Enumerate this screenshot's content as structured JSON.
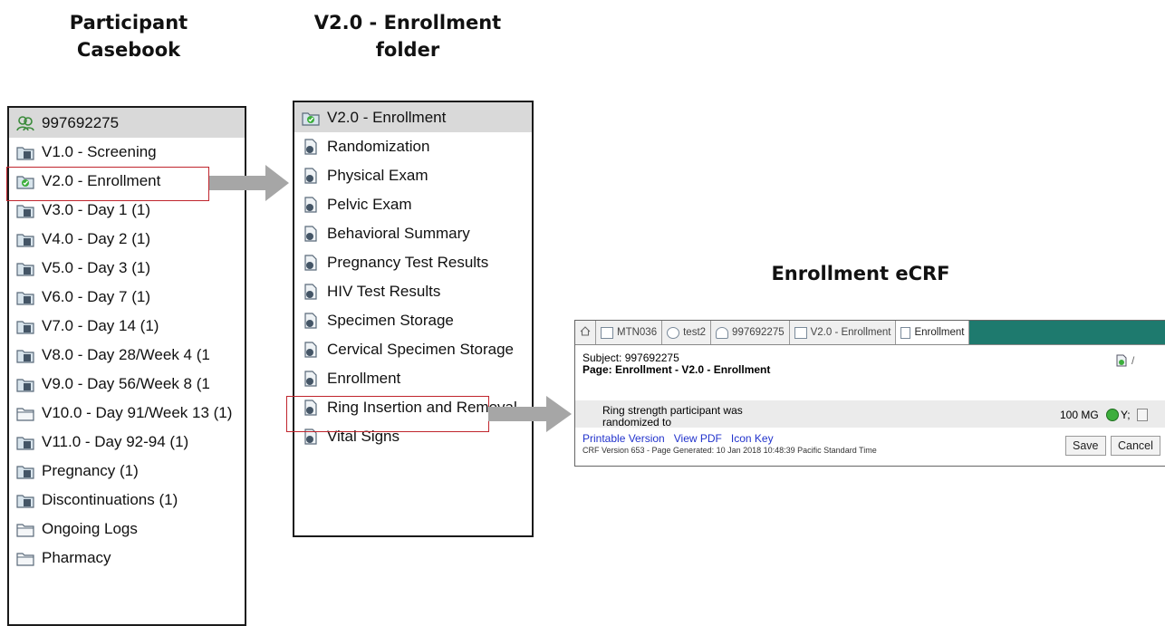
{
  "headings": {
    "casebook": [
      "Participant",
      "Casebook"
    ],
    "folder": [
      "V2.0 - Enrollment",
      "folder"
    ],
    "ecrf": "Enrollment eCRF"
  },
  "casebook": {
    "header": "997692275",
    "items": [
      {
        "label": "V1.0 - Screening",
        "icon": "folder-form-icon"
      },
      {
        "label": "V2.0 - Enrollment",
        "icon": "folder-complete-icon"
      },
      {
        "label": "V3.0 - Day 1 (1)",
        "icon": "folder-form-icon"
      },
      {
        "label": "V4.0 - Day 2 (1)",
        "icon": "folder-form-icon"
      },
      {
        "label": "V5.0 - Day 3 (1)",
        "icon": "folder-form-icon"
      },
      {
        "label": "V6.0 - Day 7 (1)",
        "icon": "folder-form-icon"
      },
      {
        "label": "V7.0 - Day 14 (1)",
        "icon": "folder-form-icon"
      },
      {
        "label": "V8.0 - Day 28/Week 4 (1",
        "icon": "folder-form-icon"
      },
      {
        "label": "V9.0 - Day 56/Week 8 (1",
        "icon": "folder-form-icon"
      },
      {
        "label": "V10.0 - Day 91/Week 13 (1)",
        "icon": "folder-empty-icon"
      },
      {
        "label": "V11.0 - Day 92-94 (1)",
        "icon": "folder-form-icon"
      },
      {
        "label": "Pregnancy (1)",
        "icon": "folder-form-icon"
      },
      {
        "label": "Discontinuations (1)",
        "icon": "folder-form-icon"
      },
      {
        "label": "Ongoing Logs",
        "icon": "folder-empty-icon"
      },
      {
        "label": "Pharmacy",
        "icon": "folder-empty-icon"
      }
    ]
  },
  "folder": {
    "header": "V2.0 - Enrollment",
    "items": [
      {
        "label": "Randomization"
      },
      {
        "label": "Physical Exam"
      },
      {
        "label": "Pelvic Exam"
      },
      {
        "label": "Behavioral Summary"
      },
      {
        "label": "Pregnancy Test Results"
      },
      {
        "label": "HIV Test Results"
      },
      {
        "label": "Specimen Storage"
      },
      {
        "label": "Cervical Specimen Storage"
      },
      {
        "label": "Enrollment"
      },
      {
        "label": "Ring Insertion and Removal"
      },
      {
        "label": "Vital Signs"
      }
    ]
  },
  "ecrf": {
    "tabs": [
      "MTN036",
      "test2",
      "997692275",
      "V2.0 - Enrollment",
      "Enrollment"
    ],
    "subject": "Subject: 997692275",
    "page": "Page: Enrollment - V2.0 - Enrollment",
    "question": "Ring strength participant was randomized to",
    "answer": "100 MG",
    "answer_flag": "Y;",
    "links": {
      "printable": "Printable Version",
      "pdf": "View PDF",
      "icon_key": "Icon Key"
    },
    "footer": "CRF Version 653 - Page Generated: 10 Jan 2018 10:48:39 Pacific Standard Time",
    "save": "Save",
    "cancel": "Cancel"
  },
  "colors": {
    "highlight": "#c0252d",
    "arrow": "#a6a6a6",
    "header_bg": "#d9d9d9",
    "tab_bar": "#1e7a6e",
    "link": "#2233cc"
  }
}
